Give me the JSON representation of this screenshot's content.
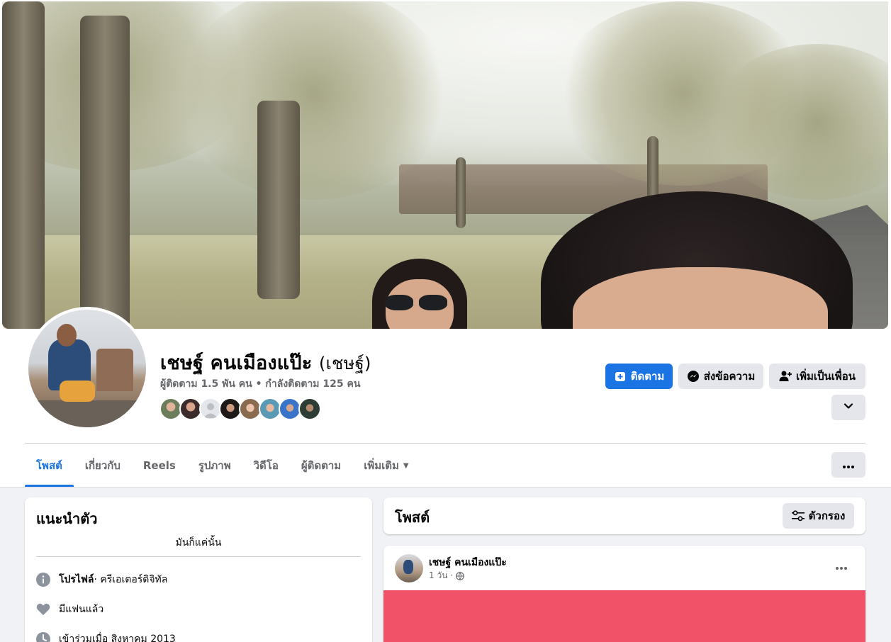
{
  "profile": {
    "name": "เชษฐ์ คนเมืองแป๊ะ",
    "alt_name": "(เชษฐ์)",
    "stats": "ผู้ติดตาม 1.5 พัน คน • กำลังติดตาม 125 คน"
  },
  "actions": {
    "follow": "ติดตาม",
    "message": "ส่งข้อความ",
    "add_friend": "เพิ่มเป็นเพื่อน"
  },
  "tabs": [
    {
      "label": "โพสต์",
      "active": true
    },
    {
      "label": "เกี่ยวกับ"
    },
    {
      "label": "Reels"
    },
    {
      "label": "รูปภาพ"
    },
    {
      "label": "วิดีโอ"
    },
    {
      "label": "ผู้ติดตาม"
    },
    {
      "label": "เพิ่มเติม"
    }
  ],
  "intro": {
    "title": "แนะนำตัว",
    "bio": "มันก็แค่นั้น",
    "profile_label": "โปรไฟล์",
    "profile_value": " · ครีเอเตอร์ดิจิทัล",
    "relationship": "มีแฟนแล้ว",
    "joined": "เข้าร่วมเมื่อ สิงหาคม 2013"
  },
  "posts": {
    "title": "โพสต์",
    "filter_label": "ตัวกรอง"
  },
  "post": {
    "author": "เชษฐ์ คนเมืองแป๊ะ",
    "time": "1 วัน ·"
  },
  "colors": {
    "accent": "#1b74e4",
    "post_media": "#f25268"
  }
}
